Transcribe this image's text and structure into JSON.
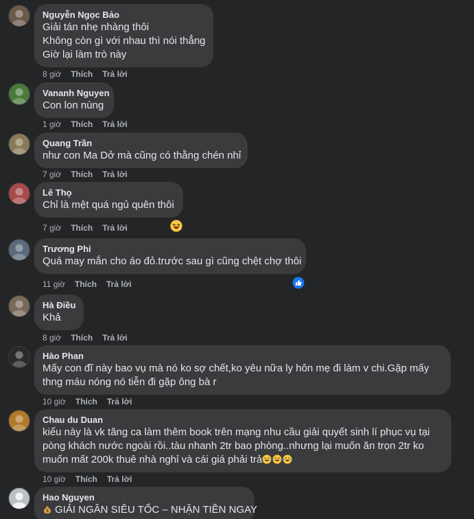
{
  "comments": [
    {
      "author": "Nguyễn Ngọc Bảo",
      "lines": [
        "Giải tán nhẹ nhàng thôi",
        "Không còn gì với nhau thì nói thẳng",
        "Giờ lại làm trò này"
      ],
      "time": "8 giờ",
      "like": "Thích",
      "reply": "Trả lời",
      "avatar_color": "#6b5a4a"
    },
    {
      "author": "Vananh Nguyen",
      "lines": [
        "Con lon nùng"
      ],
      "time": "1 giờ",
      "like": "Thích",
      "reply": "Trả lời",
      "avatar_color": "#4a7a3a"
    },
    {
      "author": "Quang Trần",
      "lines": [
        "như con Ma Dở mà cũng có thằng chén nhỉ"
      ],
      "time": "7 giờ",
      "like": "Thích",
      "reply": "Trả lời",
      "avatar_color": "#8a7a5a"
    },
    {
      "author": "Lê Thọ",
      "lines": [
        "Chỉ là mệt quá ngủ quên thôi"
      ],
      "time": "7 giờ",
      "like": "Thích",
      "reply": "Trả lời",
      "avatar_color": "#a84a4a",
      "reaction": "haha-icon"
    },
    {
      "author": "Trương Phi",
      "lines": [
        "Quá may mắn cho áo đỏ.trước sau gì cũng chệt chợ thôi"
      ],
      "time": "11 giờ",
      "like": "Thích",
      "reply": "Trả lời",
      "avatar_color": "#5a6a7a",
      "reaction": "like-icon"
    },
    {
      "author": "Hà Điều",
      "lines": [
        "Khả"
      ],
      "time": "8 giờ",
      "like": "Thích",
      "reply": "Trả lời",
      "avatar_color": "#7a6a5a"
    },
    {
      "author": "Hào Phan",
      "lines": [
        "Mấy con đĩ này bao vụ mà nó ko sợ chết,ko yêu nữa ly hôn mẹ đi làm v chi.Gặp mấy",
        "thng máu nóng nó tiễn đi gặp ông bà r"
      ],
      "time": "10 giờ",
      "like": "Thích",
      "reply": "Trả lời",
      "avatar_color": "#2a2a2a"
    },
    {
      "author": "Chau du Duan",
      "lines": [
        "kiểu này là vk tăng ca làm thêm book trên mạng nhu cầu giải quyết sinh lí phục vụ tại",
        "pòng khách nước ngoài rồi..tàu nhanh 2tr bao phòng..nhưng lại muốn ăn trọn 2tr ko",
        "muốn mất 200k thuê nhà nghỉ và cái giá phải trả"
      ],
      "time": "10 giờ",
      "like": "Thích",
      "reply": "Trả lời",
      "avatar_color": "#b07a2a",
      "trailing_emojis": [
        "tears-of-joy-icon",
        "tears-of-joy-icon",
        "tears-of-joy-icon"
      ]
    },
    {
      "author": "Hao Nguyen",
      "lines": [
        "GIẢI NGÂN SIÊU TỐC – NHẬN TIỀN NGAY"
      ],
      "time": "",
      "like": "",
      "reply": "",
      "avatar_color": "#bcc0c4",
      "leading_emoji": "money-bag-icon"
    }
  ],
  "colors": {
    "background": "#242526",
    "bubble": "#3a3b3c",
    "text": "#e4e6eb",
    "secondary": "#b0b3b8",
    "like_blue": "#1877f2"
  }
}
